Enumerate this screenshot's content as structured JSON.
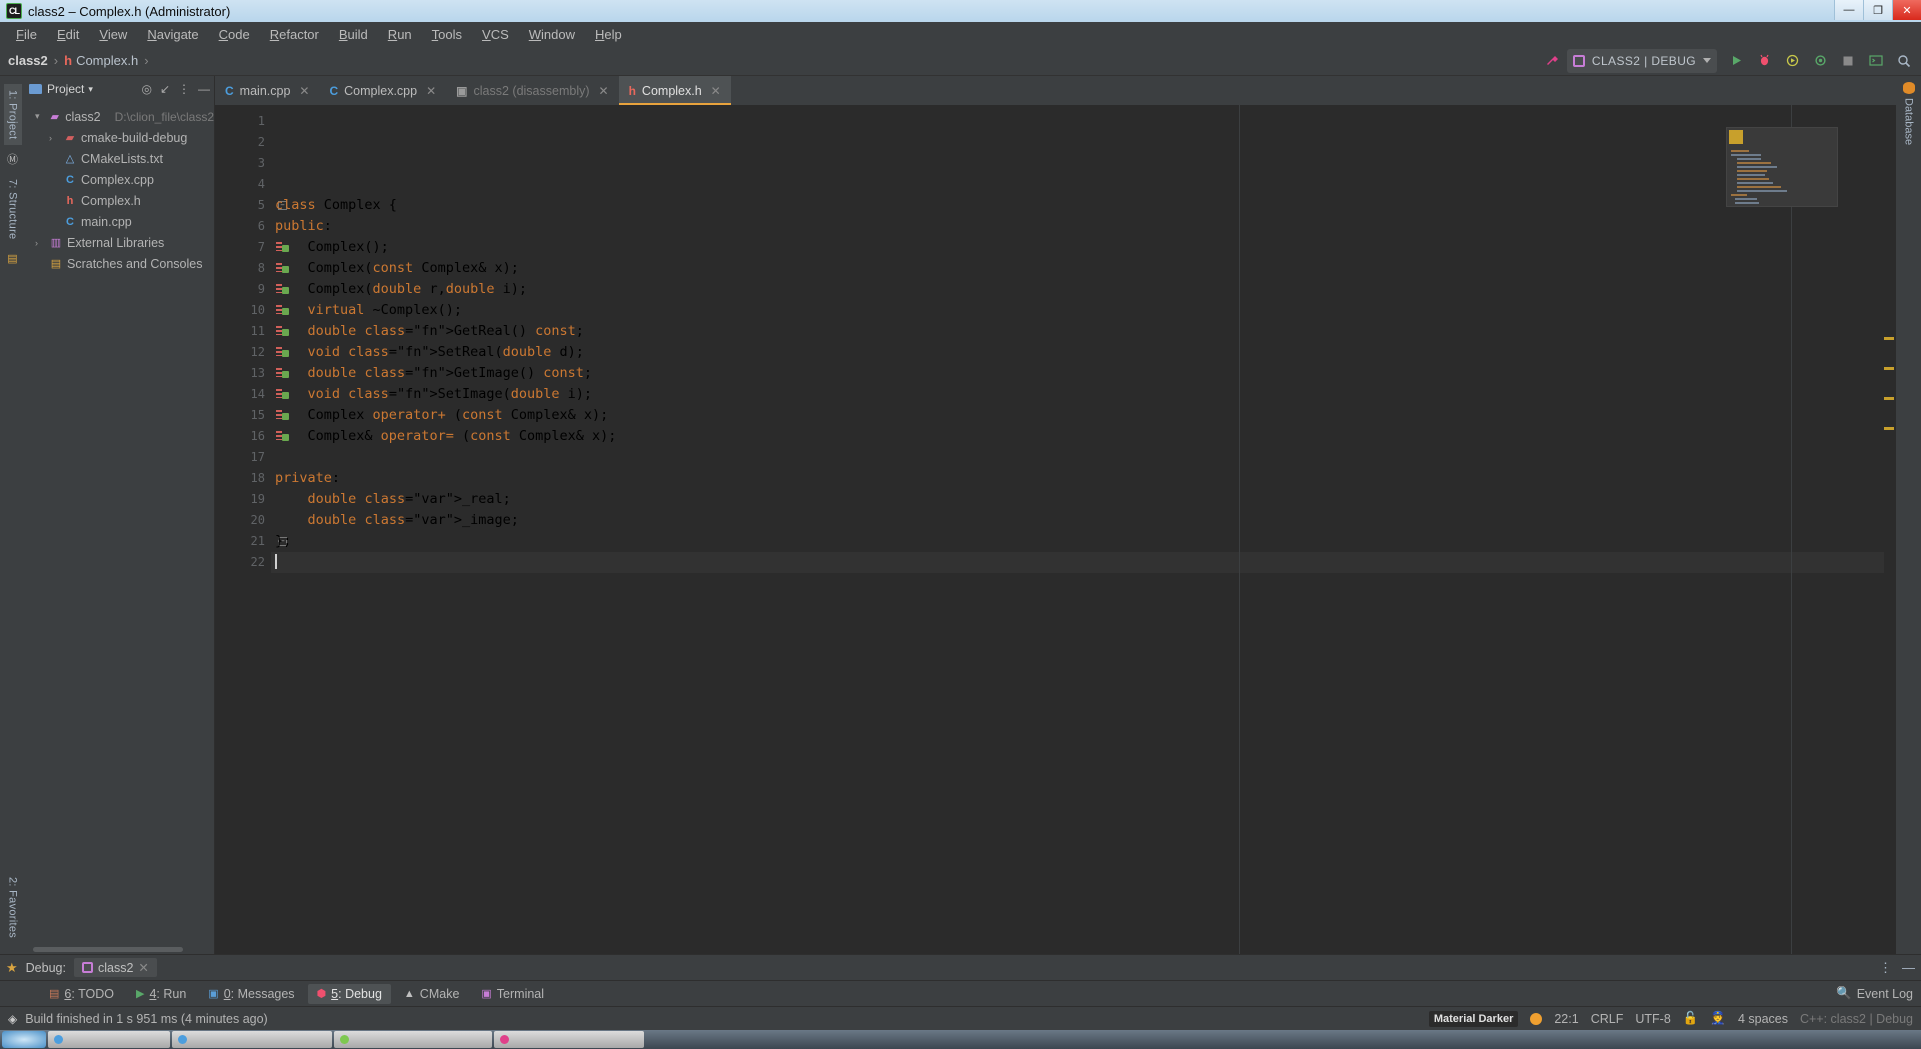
{
  "window": {
    "title": "class2 – Complex.h (Administrator)",
    "logo": "clion-logo",
    "minimize": "—",
    "maximize": "❐",
    "close": "✕"
  },
  "menu": {
    "items": [
      "File",
      "Edit",
      "View",
      "Navigate",
      "Code",
      "Refactor",
      "Build",
      "Run",
      "Tools",
      "VCS",
      "Window",
      "Help"
    ]
  },
  "navbar": {
    "breadcrumb": {
      "project": "class2",
      "file": "Complex.h",
      "separator": "›"
    },
    "run_config": {
      "label": "CLASS2 | DEBUG"
    },
    "icons": [
      "hammer-icon",
      "run-icon",
      "debug-icon",
      "attach-debug-icon",
      "profiler-icon",
      "stop-icon",
      "terminal-icon",
      "search-icon"
    ]
  },
  "left_rail": {
    "top": [
      "1: Project",
      "7: Structure"
    ],
    "bottom": "2: Favorites"
  },
  "right_rail": {
    "tab": "Database"
  },
  "project": {
    "header": "Project",
    "tree": [
      {
        "label": "class2",
        "path": "D:\\clion_file\\class2",
        "icon": "folder-project-icon",
        "arrow": "▾",
        "indent": 0
      },
      {
        "label": "cmake-build-debug",
        "path": "",
        "icon": "folder-red-icon",
        "arrow": "›",
        "indent": 1
      },
      {
        "label": "CMakeLists.txt",
        "path": "",
        "icon": "cmake-icon",
        "arrow": "",
        "indent": 1
      },
      {
        "label": "Complex.cpp",
        "path": "",
        "icon": "cpp-file-icon",
        "arrow": "",
        "indent": 1
      },
      {
        "label": "Complex.h",
        "path": "",
        "icon": "header-file-icon",
        "arrow": "",
        "indent": 1
      },
      {
        "label": "main.cpp",
        "path": "",
        "icon": "cpp-file-icon",
        "arrow": "",
        "indent": 1
      },
      {
        "label": "External Libraries",
        "path": "",
        "icon": "library-icon",
        "arrow": "›",
        "indent": 0
      },
      {
        "label": "Scratches and Consoles",
        "path": "",
        "icon": "scratch-icon",
        "arrow": "",
        "indent": 0
      }
    ]
  },
  "editor": {
    "tabs": [
      {
        "label": "main.cpp",
        "icon": "cpp-file-icon",
        "state": "normal"
      },
      {
        "label": "Complex.cpp",
        "icon": "cpp-file-icon",
        "state": "normal"
      },
      {
        "label": "class2 (disassembly)",
        "icon": "disassembly-icon",
        "state": "dim"
      },
      {
        "label": "Complex.h",
        "icon": "header-file-icon",
        "state": "active"
      }
    ],
    "close_glyph": "✕",
    "lines": [
      {
        "n": 1,
        "text": "",
        "mark": false,
        "fold": ""
      },
      {
        "n": 2,
        "text": "",
        "mark": false,
        "fold": ""
      },
      {
        "n": 3,
        "text": "",
        "mark": false,
        "fold": ""
      },
      {
        "n": 4,
        "text": "",
        "mark": false,
        "fold": ""
      },
      {
        "n": 5,
        "text": "class Complex {",
        "mark": false,
        "fold": "−"
      },
      {
        "n": 6,
        "text": "public:",
        "mark": false,
        "fold": ""
      },
      {
        "n": 7,
        "text": "    Complex();",
        "mark": true,
        "fold": ""
      },
      {
        "n": 8,
        "text": "    Complex(const Complex& x);",
        "mark": true,
        "fold": ""
      },
      {
        "n": 9,
        "text": "    Complex(double r,double i);",
        "mark": true,
        "fold": ""
      },
      {
        "n": 10,
        "text": "    virtual ~Complex();",
        "mark": true,
        "fold": ""
      },
      {
        "n": 11,
        "text": "    double GetReal() const;",
        "mark": true,
        "fold": ""
      },
      {
        "n": 12,
        "text": "    void SetReal(double d);",
        "mark": true,
        "fold": ""
      },
      {
        "n": 13,
        "text": "    double GetImage() const;",
        "mark": true,
        "fold": ""
      },
      {
        "n": 14,
        "text": "    void SetImage(double i);",
        "mark": true,
        "fold": ""
      },
      {
        "n": 15,
        "text": "    Complex operator+ (const Complex& x);",
        "mark": true,
        "fold": ""
      },
      {
        "n": 16,
        "text": "    Complex& operator= (const Complex& x);",
        "mark": true,
        "fold": ""
      },
      {
        "n": 17,
        "text": "",
        "mark": false,
        "fold": ""
      },
      {
        "n": 18,
        "text": "private:",
        "mark": false,
        "fold": ""
      },
      {
        "n": 19,
        "text": "    double _real;",
        "mark": false,
        "fold": ""
      },
      {
        "n": 20,
        "text": "    double _image;",
        "mark": false,
        "fold": ""
      },
      {
        "n": 21,
        "text": "};",
        "mark": false,
        "fold": "−"
      },
      {
        "n": 22,
        "text": "",
        "mark": false,
        "fold": "",
        "current": true
      }
    ],
    "warning_marks": 4
  },
  "debug_panel": {
    "label": "Debug:",
    "session_tab": "class2",
    "close_glyph": "✕",
    "more_glyph": "⋮",
    "minimize_glyph": "—"
  },
  "tool_windows": {
    "items": [
      {
        "label": "6: TODO",
        "icon": "todo-icon",
        "active": false
      },
      {
        "label": "4: Run",
        "icon": "run-icon",
        "active": false
      },
      {
        "label": "0: Messages",
        "icon": "messages-icon",
        "active": false
      },
      {
        "label": "5: Debug",
        "icon": "debug-icon",
        "active": true
      },
      {
        "label": "CMake",
        "icon": "cmake-icon",
        "active": false
      },
      {
        "label": "Terminal",
        "icon": "terminal-icon",
        "active": false
      }
    ],
    "event_log": "Event Log",
    "event_log_icon": "event-log-icon"
  },
  "status_bar": {
    "build_message": "Build finished in 1 s 951 ms (4 minutes ago)",
    "build_icon": "layers-icon",
    "theme": "Material Darker",
    "caret_position": "22:1",
    "line_separator": "CRLF",
    "encoding": "UTF-8",
    "lock_icon": "lock-icon",
    "inspector_icon": "inspector-icon",
    "indent": "4 spaces",
    "context": "C++: class2 | Debug"
  },
  "colors": {
    "accent_orange": "#e8a33d",
    "keyword": "#cc7832",
    "field": "#9876aa",
    "identifier": "#a9b7c6",
    "function": "#9a9a9a",
    "header_red": "#e8685c",
    "cpp_blue": "#4c9ede",
    "warning": "#c8a02c"
  },
  "taskbar": {
    "items": [
      "start",
      "app1",
      "app2",
      "app3",
      "app4"
    ]
  }
}
